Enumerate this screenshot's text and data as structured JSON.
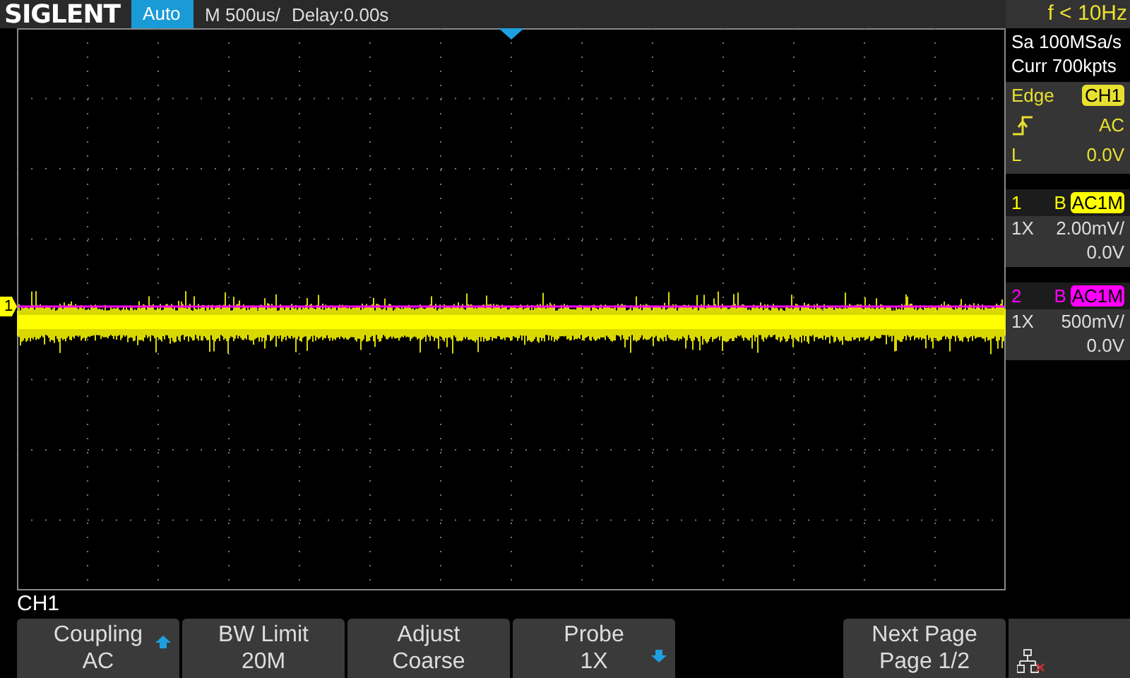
{
  "header": {
    "logo": "SIGLENT",
    "mode": "Auto",
    "timebase": "M 500us/",
    "delay": "Delay:0.00s",
    "frequency": "f < 10Hz"
  },
  "acquisition": {
    "sample_rate": "Sa 100MSa/s",
    "memory": "Curr 700kpts"
  },
  "trigger": {
    "type": "Edge",
    "source": "CH1",
    "coupling": "AC",
    "level_label": "L",
    "level": "0.0V"
  },
  "channels": [
    {
      "number": "1",
      "bandwidth": "B",
      "coupling": "AC1M",
      "probe": "1X",
      "scale": "2.00mV/",
      "offset": "0.0V",
      "color": "#ffff00"
    },
    {
      "number": "2",
      "bandwidth": "B",
      "coupling": "AC1M",
      "probe": "1X",
      "scale": "500mV/",
      "offset": "0.0V",
      "color": "#ff00ff"
    }
  ],
  "trace_marker": "1",
  "menu": {
    "title": "CH1",
    "softkeys": [
      {
        "label": "Coupling",
        "value": "AC",
        "kind": "up"
      },
      {
        "label": "BW Limit",
        "value": "20M",
        "kind": "plain"
      },
      {
        "label": "Adjust",
        "value": "Coarse",
        "kind": "plain"
      },
      {
        "label": "Probe",
        "value": "1X",
        "kind": "down"
      },
      {
        "label": "Next Page",
        "value": "Page 1/2",
        "kind": "plain"
      }
    ]
  }
}
